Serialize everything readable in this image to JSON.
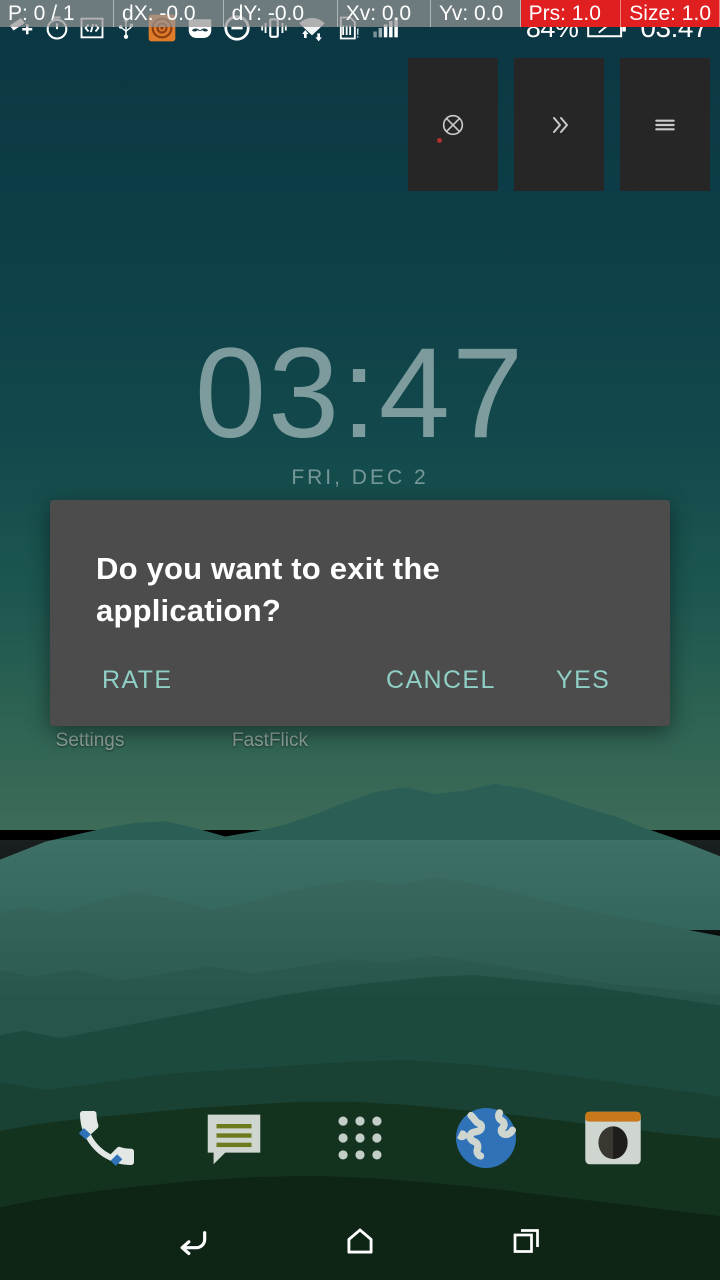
{
  "status_bar": {
    "left_icons": [
      {
        "name": "screenshot-add-icon",
        "glyph": "screenshot"
      },
      {
        "name": "timer-icon",
        "glyph": "timer"
      },
      {
        "name": "developer-code-icon",
        "glyph": "code"
      },
      {
        "name": "usb-icon",
        "glyph": "usb"
      },
      {
        "name": "orange-app-icon",
        "glyph": "orange-app"
      },
      {
        "name": "mustache-icon",
        "glyph": "mustache"
      },
      {
        "name": "do-not-disturb-icon",
        "glyph": "dnd"
      },
      {
        "name": "vibrate-icon",
        "glyph": "vibrate"
      },
      {
        "name": "wifi-transfer-icon",
        "glyph": "wifi-arrows"
      },
      {
        "name": "sim-warning-icon",
        "glyph": "sim-alert"
      },
      {
        "name": "signal-bars-icon",
        "glyph": "signal"
      }
    ],
    "battery_percent": "84%",
    "battery_icon": "battery-charging-icon",
    "clock": "03:47"
  },
  "pointer_debug": {
    "pointer_count": "P: 0 / 1",
    "delta_x": "dX: -0.0",
    "delta_y": "dY: -0.0",
    "velocity_x": "Xv: 0.0",
    "velocity_y": "Yv: 0.0",
    "close_glyph": "×",
    "pressure": "Prs: 1.0",
    "size": "Size: 1.0",
    "cell_bg": "#969696",
    "alert_bg": "#e02020"
  },
  "top_panels": [
    {
      "name": "panel-close",
      "icon": "circle-x-icon"
    },
    {
      "name": "panel-forward",
      "icon": "double-chevron-right-icon"
    },
    {
      "name": "panel-menu",
      "icon": "hamburger-menu-icon"
    }
  ],
  "clock_widget": {
    "time": "03:47",
    "date": "FRI, DEC 2"
  },
  "home_apps": [
    {
      "name": "app-settings",
      "label": "Settings"
    },
    {
      "name": "app-fastflick",
      "label": "FastFlick"
    }
  ],
  "dialog": {
    "message": "Do you want to exit the application?",
    "buttons": [
      {
        "name": "rate-button",
        "label": "RATE"
      },
      {
        "name": "cancel-button",
        "label": "CANCEL"
      },
      {
        "name": "yes-button",
        "label": "YES"
      }
    ],
    "background_color": "#4c4c4c",
    "button_color": "#8fcfc5",
    "text_color": "#ffffff"
  },
  "dock": [
    {
      "name": "dock-phone",
      "icon": "phone-icon"
    },
    {
      "name": "dock-messages",
      "icon": "messages-icon"
    },
    {
      "name": "dock-app-drawer",
      "icon": "app-drawer-icon"
    },
    {
      "name": "dock-browser",
      "icon": "globe-browser-icon"
    },
    {
      "name": "dock-camera",
      "icon": "camera-icon"
    }
  ],
  "nav_bar": [
    {
      "name": "nav-back",
      "icon": "back-arrow-icon"
    },
    {
      "name": "nav-home",
      "icon": "home-icon"
    },
    {
      "name": "nav-recents",
      "icon": "recents-icon"
    }
  ],
  "theme": {
    "sky_top": "#0a3642",
    "sky_bottom": "#3d6c58",
    "accent_teal": "#8fcfc5",
    "panel_bg": "#262626"
  }
}
